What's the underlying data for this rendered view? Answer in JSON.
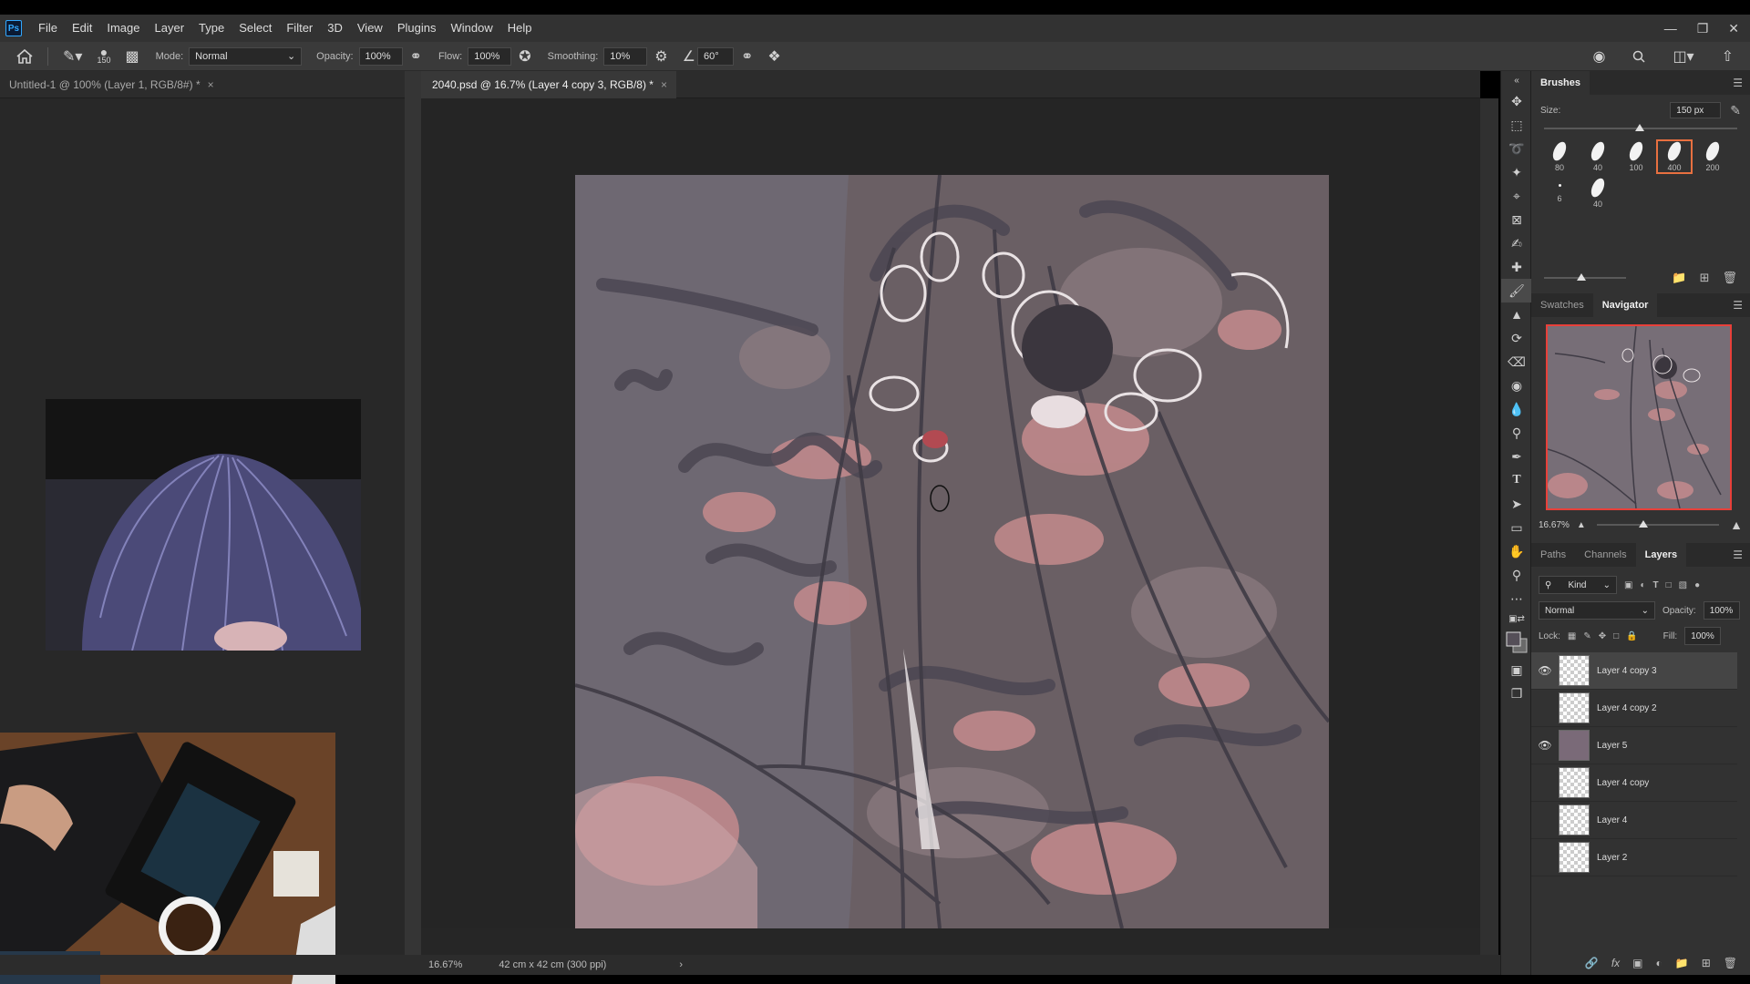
{
  "app": {
    "name": "Ps"
  },
  "menu": [
    "File",
    "Edit",
    "Image",
    "Layer",
    "Type",
    "Select",
    "Filter",
    "3D",
    "View",
    "Plugins",
    "Window",
    "Help"
  ],
  "options": {
    "brush_size": "150",
    "mode_label": "Mode:",
    "mode_value": "Normal",
    "opacity_label": "Opacity:",
    "opacity_value": "100%",
    "flow_label": "Flow:",
    "flow_value": "100%",
    "smoothing_label": "Smoothing:",
    "smoothing_value": "10%",
    "angle_value": "60°"
  },
  "docs": {
    "left_tab": "Untitled-1 @ 100% (Layer 1, RGB/8#) *",
    "main_tab": "2040.psd @ 16.7% (Layer 4 copy 3, RGB/8) *"
  },
  "status": {
    "zoom": "16.67%",
    "doc_size": "42 cm x 42 cm (300 ppi)"
  },
  "brushes": {
    "tab": "Brushes",
    "size_label": "Size:",
    "size_value": "150 px",
    "presets": [
      "80",
      "40",
      "100",
      "400",
      "200",
      "6",
      "40"
    ],
    "selected_index": 3
  },
  "navigator": {
    "tabs": [
      "Swatches",
      "Navigator"
    ],
    "zoom": "16.67%"
  },
  "layers": {
    "tabs": [
      "Paths",
      "Channels",
      "Layers"
    ],
    "filter_kind": "Kind",
    "blend_mode": "Normal",
    "opacity_label": "Opacity:",
    "opacity_value": "100%",
    "lock_label": "Lock:",
    "fill_label": "Fill:",
    "fill_value": "100%",
    "items": [
      {
        "name": "Layer 4 copy 3",
        "visible": true,
        "active": true
      },
      {
        "name": "Layer 4 copy 2",
        "visible": false,
        "active": false
      },
      {
        "name": "Layer 5",
        "visible": true,
        "active": false
      },
      {
        "name": "Layer 4 copy",
        "visible": false,
        "active": false
      },
      {
        "name": "Layer 4",
        "visible": false,
        "active": false
      },
      {
        "name": "Layer 2",
        "visible": false,
        "active": false
      }
    ]
  }
}
